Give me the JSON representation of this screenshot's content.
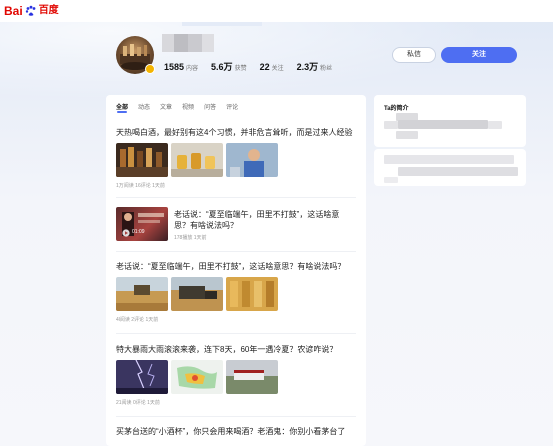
{
  "brand": {
    "logo_latin": "Bai",
    "logo_cn": "百度"
  },
  "profile": {
    "stats": [
      {
        "value": "1585",
        "label": "内容"
      },
      {
        "value": "5.6万",
        "label": "获赞"
      },
      {
        "value": "22",
        "label": "关注"
      },
      {
        "value": "2.3万",
        "label": "粉丝"
      }
    ],
    "message_button": "私信",
    "follow_button": "关注"
  },
  "feed": {
    "tabs": [
      "全部",
      "动态",
      "文章",
      "视频",
      "问答",
      "评论"
    ],
    "active_tab": 0,
    "items": [
      {
        "title": "天热喝白酒，最好别有这4个习惯，并非危言耸听，而是过来人经验",
        "meta": "1万阅读 16评论 1天前"
      },
      {
        "title_line1": "老话说：“夏至临端午，田里不打鼓”，这话啥意",
        "title_line2": "思？有啥说法吗？",
        "meta": "178播放 1天前",
        "video_duration": "01:09"
      },
      {
        "title": "老话说：“夏至临端午，田里不打鼓”，这话啥意思？有啥说法吗？",
        "meta": "4l阅读 2评论 1天前"
      },
      {
        "title": "特大暴雨大雨滚滚来袭，连下8天，60年一遇冷夏？农谚咋说？",
        "meta": "21阅读 0评论 1天前"
      },
      {
        "title": "买茅台送的“小酒杯”，你只会用来喝酒？老酒鬼：你别小看茅台了"
      }
    ]
  },
  "sidebar": {
    "intro_heading": "Ta的简介"
  },
  "colors": {
    "accent": "#4e6ef2",
    "brand_red": "#e10601",
    "badge": "#f4b400"
  }
}
